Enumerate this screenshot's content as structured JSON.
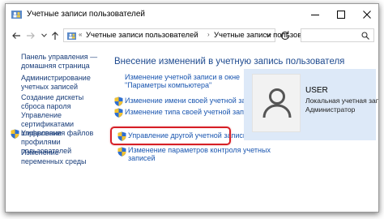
{
  "window": {
    "title": "Учетные записи пользователей"
  },
  "address_bar": {
    "separator": "«",
    "crumbs": [
      "Учетные записи пользователей",
      "Учетные записи пользователей"
    ],
    "crumb_sep": "›"
  },
  "sidebar": {
    "items": [
      {
        "label": "Панель управления — домашняя страница",
        "shield": false
      },
      {
        "label": "Администрирование учетных записей",
        "shield": false
      },
      {
        "label": "Создание дискеты сброса пароля",
        "shield": false
      },
      {
        "label": "Управление сертификатами шифрования файлов",
        "shield": false
      },
      {
        "label": "Управление профилями пользователей",
        "shield": true
      },
      {
        "label": "Изменение переменных среды",
        "shield": false
      }
    ]
  },
  "main": {
    "heading": "Внесение изменений в учетную запись пользователя",
    "link_settings_1": "Изменение учетной записи в окне",
    "link_settings_2": "\"Параметры компьютера\"",
    "link_rename": "Изменение имени своей учетной записи",
    "link_type": "Изменение типа своей учетной записи",
    "link_manage_other": "Управление другой учетной записью",
    "link_uac_1": "Изменение параметров контроля учетных",
    "link_uac_2": "записей"
  },
  "user_card": {
    "name": "USER",
    "account_type": "Локальная учетная запись",
    "role": "Администратор"
  },
  "colors": {
    "link": "#1a56b0",
    "heading": "#1e4a8f",
    "highlight": "#d61f26",
    "card_bg": "#dde9f8"
  },
  "icons": {
    "title": "users-folder-icon",
    "minimize": "minimize-icon",
    "maximize": "maximize-icon",
    "close": "close-icon",
    "back": "arrow-left-icon",
    "forward": "arrow-right-icon",
    "up": "arrow-up-icon",
    "refresh": "refresh-icon",
    "search": "search-icon",
    "shield": "uac-shield-icon",
    "avatar": "user-avatar-icon"
  }
}
